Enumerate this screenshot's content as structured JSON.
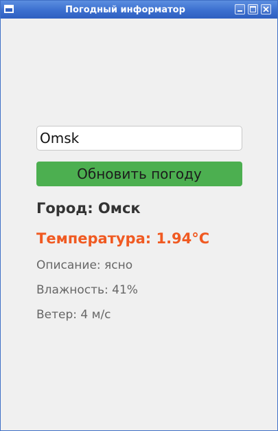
{
  "window": {
    "title": "Погодный информатор",
    "controls": [
      "minimize-icon",
      "maximize-icon",
      "close-icon"
    ],
    "titlebar_color": "#3b6fcf"
  },
  "form": {
    "city_value": "Omsk",
    "button_label": "Обновить погоду",
    "button_color": "#4caf50"
  },
  "weather": {
    "city_text": "Город: Омск",
    "temperature_text": "Температура: 1.94°C",
    "temperature_color": "#f05a22",
    "description_text": "Описание: ясно",
    "humidity_text": "Влажность: 41%",
    "wind_text": "Ветер: 4 м/с"
  }
}
